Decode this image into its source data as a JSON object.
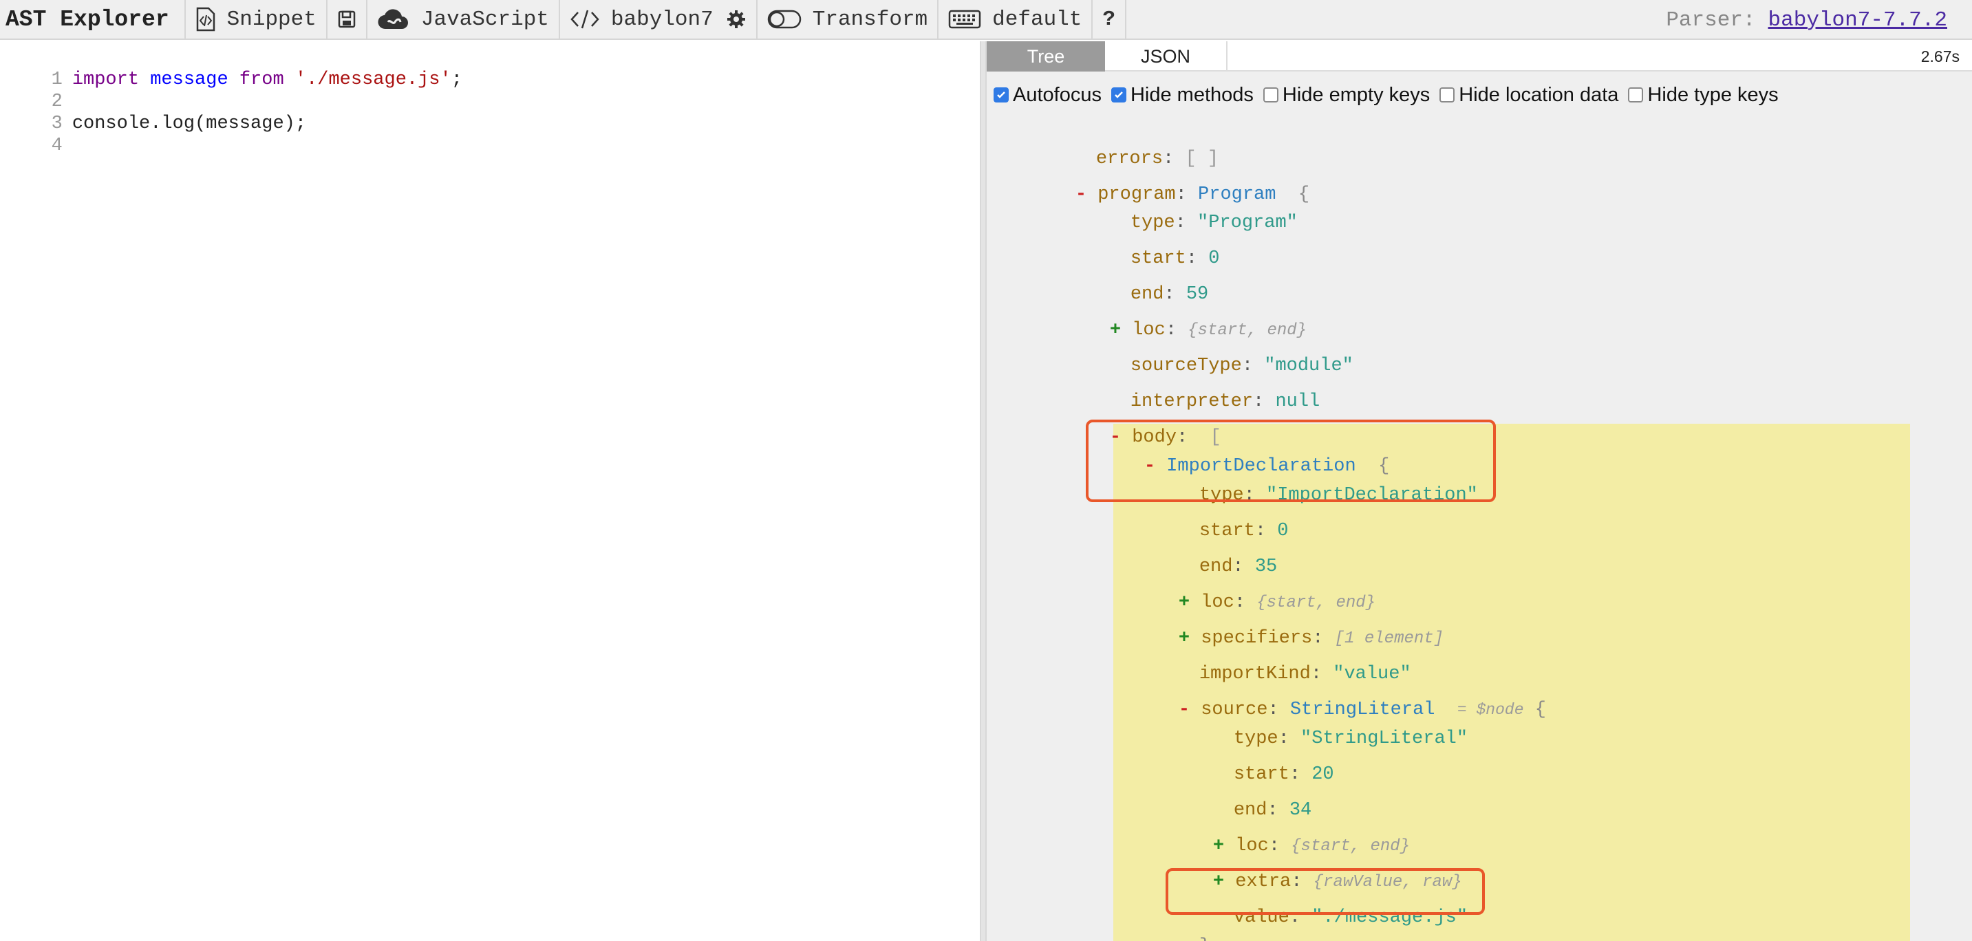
{
  "toolbar": {
    "logo": "AST Explorer",
    "snippet_label": "Snippet",
    "language_label": "JavaScript",
    "parser_name_label": "babylon7",
    "transform_label": "Transform",
    "keymap_label": "default",
    "help_label": "?",
    "parser_prefix": "Parser:",
    "parser_link": "babylon7-7.7.2",
    "icons": [
      "snippet-icon",
      "save-icon",
      "cloud-icon",
      "code-icon",
      "gear-icon",
      "toggle-icon",
      "keyboard-icon",
      "help-icon"
    ]
  },
  "editor": {
    "line_numbers": [
      "1",
      "2",
      "3",
      "4"
    ],
    "line1": {
      "import_kw": "import",
      "ident": "message",
      "from_kw": "from",
      "string": "'./message.js'",
      "semi": ";"
    },
    "line3": {
      "text": "console.log(message);"
    }
  },
  "output": {
    "tabs": [
      "Tree",
      "JSON"
    ],
    "active_tab": "Tree",
    "time": "2.67s",
    "options": [
      {
        "label": "Autofocus",
        "checked": true
      },
      {
        "label": "Hide methods",
        "checked": true
      },
      {
        "label": "Hide empty keys",
        "checked": false
      },
      {
        "label": "Hide location data",
        "checked": false
      },
      {
        "label": "Hide type keys",
        "checked": false
      }
    ]
  },
  "tree": {
    "errors": {
      "key": "errors",
      "value": "[ ]"
    },
    "program": {
      "toggle": "-",
      "key": "program",
      "type": "Program",
      "brace": "{"
    },
    "program_type": {
      "key": "type",
      "value": "\"Program\""
    },
    "program_start": {
      "key": "start",
      "value": "0"
    },
    "program_end": {
      "key": "end",
      "value": "59"
    },
    "program_loc": {
      "toggle": "+",
      "key": "loc",
      "summary": "{start, end}"
    },
    "program_sourceType": {
      "key": "sourceType",
      "value": "\"module\""
    },
    "program_interpreter": {
      "key": "interpreter",
      "value": "null"
    },
    "body": {
      "toggle": "-",
      "key": "body",
      "bracket": "["
    },
    "import_decl": {
      "toggle": "-",
      "type": "ImportDeclaration",
      "brace": "{"
    },
    "import_type": {
      "key": "type",
      "value": "\"ImportDeclaration\""
    },
    "import_start": {
      "key": "start",
      "value": "0"
    },
    "import_end": {
      "key": "end",
      "value": "35"
    },
    "import_loc": {
      "toggle": "+",
      "key": "loc",
      "summary": "{start, end}"
    },
    "import_specifiers": {
      "toggle": "+",
      "key": "specifiers",
      "summary": "[1 element]"
    },
    "import_kind": {
      "key": "importKind",
      "value": "\"value\""
    },
    "source": {
      "toggle": "-",
      "key": "source",
      "type": "StringLiteral",
      "tag": "= $node",
      "brace": "{"
    },
    "source_type": {
      "key": "type",
      "value": "\"StringLiteral\""
    },
    "source_start": {
      "key": "start",
      "value": "20"
    },
    "source_end": {
      "key": "end",
      "value": "34"
    },
    "source_loc": {
      "toggle": "+",
      "key": "loc",
      "summary": "{start, end}"
    },
    "source_extra": {
      "toggle": "+",
      "key": "extra",
      "summary": "{rawValue, raw}"
    },
    "source_value": {
      "key": "value",
      "value": "\"./message.js\""
    },
    "source_close": "}"
  },
  "colors": {
    "highlight": "#f3eda5",
    "annotation_box": "#e9572a",
    "key": "#9a6b0e",
    "node_type": "#2e7fc0",
    "string_value": "#2f9a8a"
  }
}
